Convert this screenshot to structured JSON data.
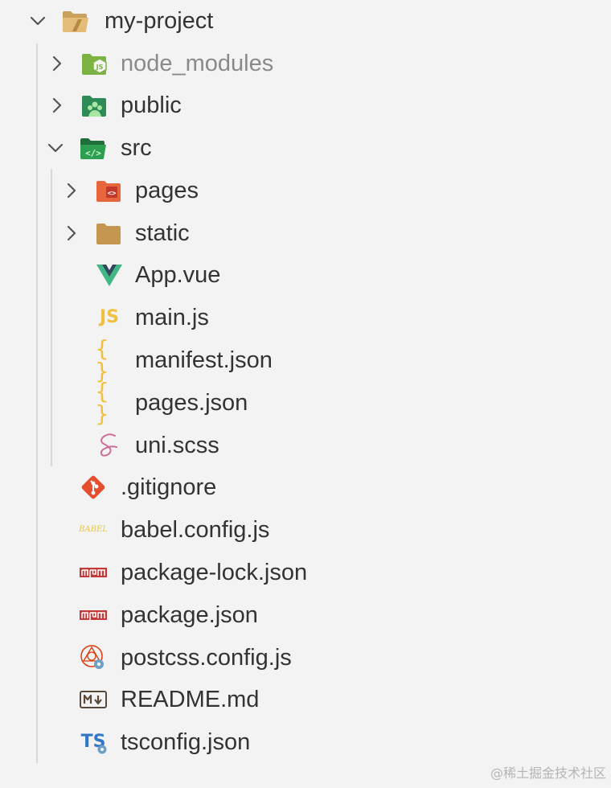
{
  "explorer": {
    "root": {
      "label": "my-project",
      "icon": "folder-open-icon"
    },
    "items": [
      {
        "label": "node_modules",
        "icon": "nodejs-folder-icon",
        "expanded": false
      },
      {
        "label": "public",
        "icon": "public-folder-icon",
        "expanded": false
      },
      {
        "label": "src",
        "icon": "src-folder-open-icon",
        "expanded": true
      },
      {
        "label": "pages",
        "icon": "pages-folder-icon",
        "expanded": false
      },
      {
        "label": "static",
        "icon": "folder-icon",
        "expanded": false
      },
      {
        "label": "App.vue",
        "icon": "vue-icon"
      },
      {
        "label": "main.js",
        "icon": "javascript-icon",
        "icon_text": "JS"
      },
      {
        "label": "manifest.json",
        "icon": "json-icon",
        "icon_text": "{ }"
      },
      {
        "label": "pages.json",
        "icon": "json-icon",
        "icon_text": "{ }"
      },
      {
        "label": "uni.scss",
        "icon": "sass-icon"
      },
      {
        "label": ".gitignore",
        "icon": "git-icon"
      },
      {
        "label": "babel.config.js",
        "icon": "babel-icon",
        "icon_text": "BABEL"
      },
      {
        "label": "package-lock.json",
        "icon": "npm-icon"
      },
      {
        "label": "package.json",
        "icon": "npm-icon"
      },
      {
        "label": "postcss.config.js",
        "icon": "postcss-icon"
      },
      {
        "label": "README.md",
        "icon": "markdown-icon"
      },
      {
        "label": "tsconfig.json",
        "icon": "typescript-config-icon",
        "icon_text": "TS"
      }
    ]
  },
  "watermark": "@稀土掘金技术社区",
  "colors": {
    "background": "#f3f3f3",
    "text": "#333333",
    "dim_text": "#8a8a8a",
    "guide": "#d8d8d8",
    "js_yellow": "#f0c040",
    "vue_green": "#41b883",
    "vue_dark": "#35495e",
    "git_red": "#e44d2e",
    "npm_red": "#c53838",
    "sass_pink": "#cf6d9a",
    "ts_blue": "#3178c6"
  }
}
